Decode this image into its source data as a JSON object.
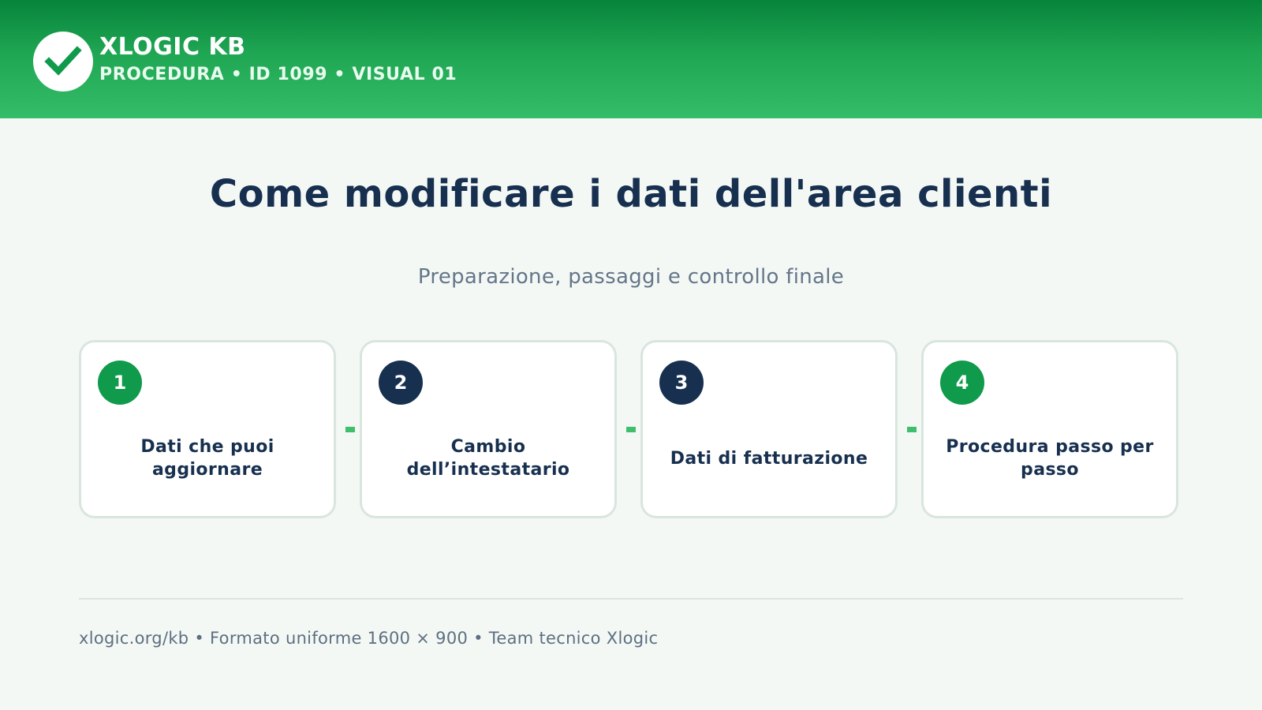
{
  "header": {
    "brand": "XLOGIC KB",
    "subline": "PROCEDURA • ID 1099 • VISUAL 01",
    "logo_icon": "checkmark-icon"
  },
  "main": {
    "title": "Come modificare i dati dell'area clienti",
    "subtitle": "Preparazione, passaggi e controllo finale",
    "steps": [
      {
        "number": "1",
        "label": "Dati che puoi aggiornare",
        "badge_color": "#0f9a4c"
      },
      {
        "number": "2",
        "label": "Cambio dell’intestatario",
        "badge_color": "#17304f"
      },
      {
        "number": "3",
        "label": "Dati di fatturazione",
        "badge_color": "#17304f"
      },
      {
        "number": "4",
        "label": "Procedura passo per passo",
        "badge_color": "#0f9a4c"
      }
    ]
  },
  "footer": {
    "text": "xlogic.org/kb • Formato uniforme 1600 × 900 • Team tecnico Xlogic"
  },
  "colors": {
    "header_green": "#1fa653",
    "accent_green": "#0f9a4c",
    "navy": "#17304f",
    "background": "#f4f8f5"
  }
}
